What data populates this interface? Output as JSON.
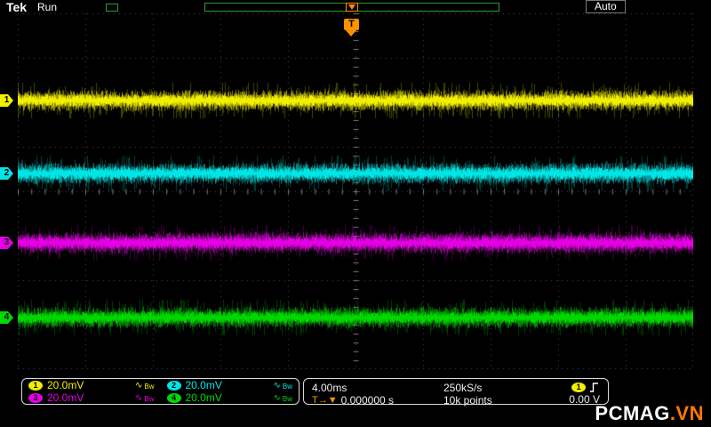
{
  "header": {
    "brand": "Tek",
    "status": "Run",
    "trigger_mode": "Auto",
    "trigger_marker": "T"
  },
  "channels": [
    {
      "id": "1",
      "scale": "20.0mV",
      "coupling_icon": "∿",
      "bw_icon": "Bw",
      "color": "#f2ef00"
    },
    {
      "id": "2",
      "scale": "20.0mV",
      "coupling_icon": "∿",
      "bw_icon": "Bw",
      "color": "#00e6e6"
    },
    {
      "id": "3",
      "scale": "20.0mV",
      "coupling_icon": "∿",
      "bw_icon": "Bw",
      "color": "#e600e6"
    },
    {
      "id": "4",
      "scale": "20.0mV",
      "coupling_icon": "∿",
      "bw_icon": "Bw",
      "color": "#00d800"
    }
  ],
  "timebase": {
    "scale": "4.00ms",
    "sample_rate": "250kS/s",
    "record_length": "10k points",
    "trigger_time_icon": "T→▼",
    "trigger_time": "0.000000 s"
  },
  "trigger": {
    "source_id": "1",
    "slope": "rising",
    "level": "0.00 V"
  },
  "watermark": {
    "main": "PCMAG",
    "accent": ".VN"
  },
  "colors": {
    "trigger_orange": "#ff9000",
    "grid": "#4a4a55",
    "background": "#000000",
    "graticule_tick": "#7a7a7a"
  },
  "chart_data": {
    "type": "line",
    "title": "4-channel oscilloscope noise traces",
    "divisions": {
      "x": 10,
      "y": 8
    },
    "time_per_div": "4.00ms",
    "x_range_ms": [
      -20,
      20
    ],
    "sample_rate": "250kS/s",
    "record_length": "10k points",
    "trigger": {
      "source": "CH1",
      "mode": "Auto",
      "status": "Run",
      "slope": "rising",
      "level_v": "0.00 V",
      "position_s": "0.000000 s"
    },
    "channels": [
      {
        "name": "CH1",
        "volts_per_div": "20.0mV",
        "color": "#f2ef00",
        "center_div": 1.96,
        "noise_pp_div": 0.5
      },
      {
        "name": "CH2",
        "volts_per_div": "20.0mV",
        "color": "#00e6e6",
        "center_div": 3.6,
        "noise_pp_div": 0.5
      },
      {
        "name": "CH3",
        "volts_per_div": "20.0mV",
        "color": "#e600e6",
        "center_div": 5.16,
        "noise_pp_div": 0.6
      },
      {
        "name": "CH4",
        "volts_per_div": "20.0mV",
        "color": "#00d800",
        "center_div": 6.84,
        "noise_pp_div": 0.5
      }
    ]
  }
}
